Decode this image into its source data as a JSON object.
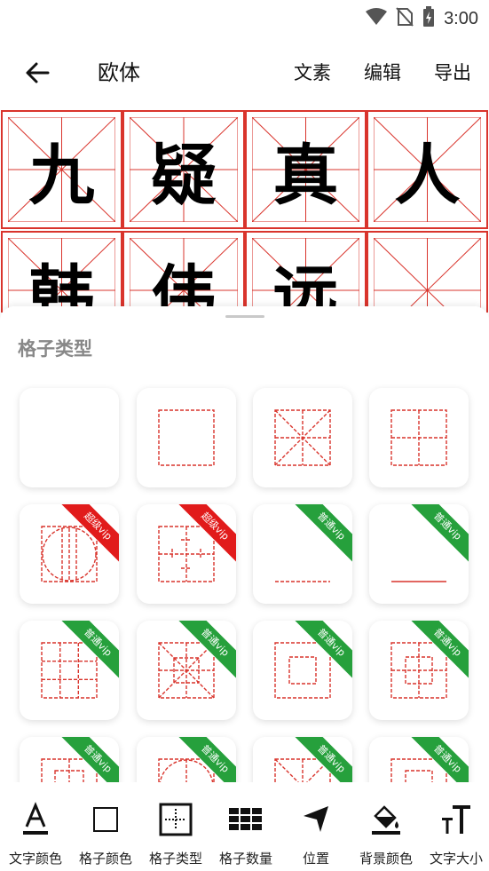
{
  "status": {
    "time": "3:00"
  },
  "appbar": {
    "title": "欧体",
    "actions": [
      "文素",
      "编辑",
      "导出"
    ]
  },
  "grid": {
    "characters": [
      "九",
      "疑",
      "真",
      "人",
      "韩",
      "伟",
      "远",
      ""
    ]
  },
  "sheet": {
    "title": "格子类型",
    "cards": [
      {
        "pattern": "blank",
        "badge": ""
      },
      {
        "pattern": "square",
        "badge": ""
      },
      {
        "pattern": "mi",
        "badge": ""
      },
      {
        "pattern": "tian",
        "badge": ""
      },
      {
        "pattern": "circle",
        "badge": "超级vip",
        "badge_color": "#e11b1b"
      },
      {
        "pattern": "cross-arrows",
        "badge": "超级vip",
        "badge_color": "#e11b1b"
      },
      {
        "pattern": "dashed-line",
        "badge": "普通vip",
        "badge_color": "#26a03c"
      },
      {
        "pattern": "solid-line",
        "badge": "普通vip",
        "badge_color": "#26a03c"
      },
      {
        "pattern": "nine-grid",
        "badge": "普通vip",
        "badge_color": "#26a03c"
      },
      {
        "pattern": "mi-center",
        "badge": "普通vip",
        "badge_color": "#26a03c"
      },
      {
        "pattern": "nested-square",
        "badge": "普通vip",
        "badge_color": "#26a03c"
      },
      {
        "pattern": "hui",
        "badge": "普通vip",
        "badge_color": "#26a03c"
      },
      {
        "pattern": "partial-1",
        "badge": "普通vip",
        "badge_color": "#26a03c"
      },
      {
        "pattern": "partial-2",
        "badge": "普通vip",
        "badge_color": "#26a03c"
      },
      {
        "pattern": "partial-3",
        "badge": "普通vip",
        "badge_color": "#26a03c"
      },
      {
        "pattern": "partial-4",
        "badge": "普通vip",
        "badge_color": "#26a03c"
      }
    ]
  },
  "toolbar": {
    "items": [
      {
        "label": "文字颜色",
        "icon": "text-color-icon"
      },
      {
        "label": "格子颜色",
        "icon": "grid-color-icon"
      },
      {
        "label": "格子类型",
        "icon": "grid-type-icon"
      },
      {
        "label": "格子数量",
        "icon": "grid-count-icon"
      },
      {
        "label": "位置",
        "icon": "position-icon"
      },
      {
        "label": "背景颜色",
        "icon": "background-color-icon"
      },
      {
        "label": "文字大小",
        "icon": "text-size-icon"
      }
    ]
  },
  "colors": {
    "grid_red": "#d9342c",
    "accent_red": "#e11b1b",
    "vip_green": "#26a03c"
  }
}
